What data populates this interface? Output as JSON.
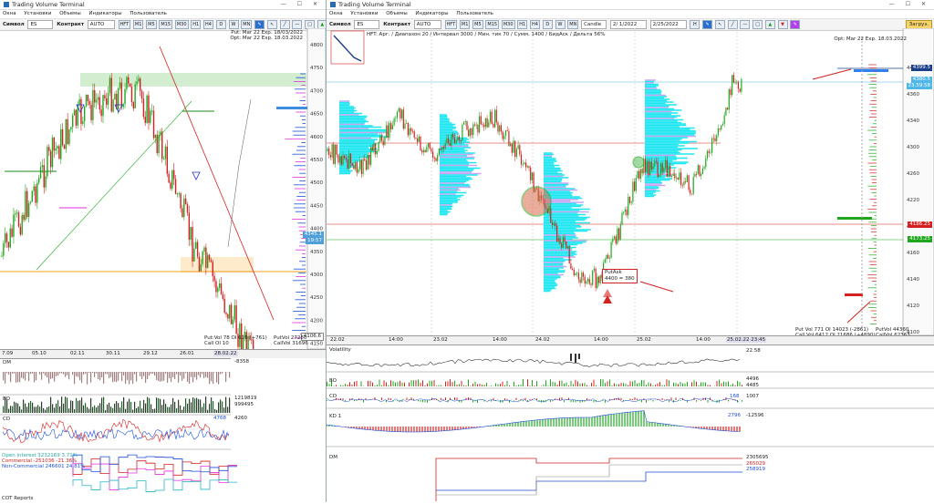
{
  "left": {
    "title": "Trading Volume Terminal",
    "menu": [
      "Окна",
      "Установки",
      "Объемы",
      "Индикаторы",
      "Пользователь"
    ],
    "symbol_label": "Символ",
    "symbol": "ES",
    "contract_label": "Контракт",
    "contract": "AUTO",
    "timeframes": [
      "HFT",
      "M1",
      "M5",
      "M15",
      "M30",
      "H1",
      "H4",
      "D",
      "W",
      "MN"
    ],
    "info_put": "Put: Mar 22 Exp. 18/03/2022",
    "info_opt": "Opt: Mar 22 Exp. 18.03.2022",
    "price_ticks": [
      "4800",
      "4750",
      "4700",
      "4650",
      "4600",
      "4550",
      "4500",
      "4450",
      "4400",
      "4350",
      "4300",
      "4250",
      "4200",
      "4150"
    ],
    "last_price": "4345.1",
    "last_price2": "19:57",
    "bottom_price": "4106.6",
    "dates": [
      "7.09",
      "05.10",
      "02.11",
      "30.11",
      "29.12",
      "26.01",
      "28.02.22"
    ],
    "vol_bottom": [
      "Put:Vol 78  OI 616 (+761)",
      "Call OI 10"
    ],
    "vol_right": [
      "PutVol 27280",
      "CallVol 31696"
    ],
    "dm_label": "DM",
    "dm_value": "-8358",
    "bo_label": "BO",
    "bo_values": [
      "1219819",
      "999495"
    ],
    "cd_label": "CD",
    "cd_value": "4260",
    "cd_value2": "4768",
    "cot": {
      "open_interest": "Open interest   3232169   3.71%",
      "commercial": "Commercial       -251036  -21.36%",
      "non_commercial": "Non-Commercial   246601   24.81%",
      "footer": "COT Reports"
    }
  },
  "right": {
    "title": "Trading Volume Terminal",
    "menu": [
      "Окна",
      "Установки",
      "Объемы",
      "Индикаторы",
      "Пользователь"
    ],
    "symbol_label": "Символ",
    "symbol": "ES",
    "contract_label": "Контракт",
    "contract": "AUTO",
    "timeframes": [
      "HFT",
      "M1",
      "M5",
      "M15",
      "M30",
      "H1",
      "H4",
      "D",
      "W",
      "MN"
    ],
    "chart_type": "Candle",
    "date_from": "2/ 1/2022",
    "date_to": "2/25/2022",
    "load_button": "Загруз.",
    "header_info": "HFT: Арг. / Диапазон 20 / Интервал 3000 / Мин. тик 70 / Сумм. 1400 / БидАск / Дельта 56%",
    "info_opt": "Opt: Mar 22 Exp. 18.03.2022",
    "price_ticks": [
      "4400",
      "4360",
      "4340",
      "4300",
      "4260",
      "4220",
      "4180",
      "4160",
      "4140",
      "4120",
      "4100"
    ],
    "boxes": {
      "p1": "4399.5",
      "p2": "4380.5",
      "p3": "23.59.58",
      "p4": "4186.25",
      "p5": "4173.25"
    },
    "dates": [
      "22.02",
      "14:00",
      "23.02",
      "14:00",
      "24.02",
      "14:00",
      "25.02",
      "14:00",
      "25.02.22 23:45"
    ],
    "annotation": [
      "PutAsk",
      "4400 = 380"
    ],
    "vol_bottom": [
      "Put Vol  771  OI 14023 (-2861)",
      "Call Vol 6412  OI 21686 (+4890)"
    ],
    "vol_right": [
      "PutVol 44360",
      "CallVol 62363"
    ],
    "volatility_label": "Volatility",
    "volatility_value": "22.58",
    "bo_label": "BO",
    "bo_values": [
      "4496",
      "4485"
    ],
    "cd_label": "CD",
    "cd_values": [
      "168",
      "1007"
    ],
    "kd_label": "KD 1",
    "kd_values": [
      "2796",
      "-12596"
    ],
    "dm_label": "DM",
    "dm_values": [
      "2305695",
      "265029",
      "258919"
    ]
  },
  "colors": {
    "up": "#1fa81f",
    "down": "#d42020",
    "cyan": "#1fe6f0",
    "violet": "#c9a6f2",
    "blue": "#1d4fd8",
    "magenta": "#e030e0"
  }
}
